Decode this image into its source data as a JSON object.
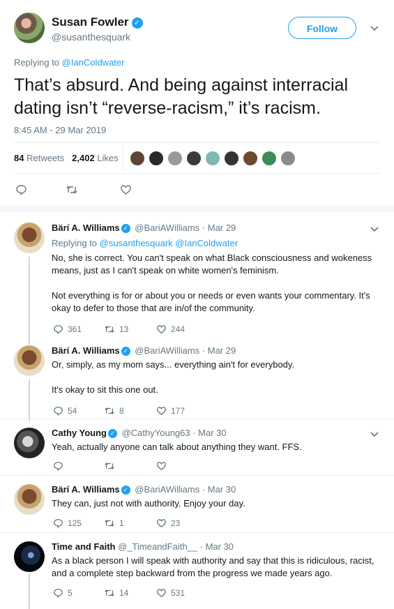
{
  "main_tweet": {
    "author_name": "Susan Fowler",
    "author_handle": "@susanthesquark",
    "follow_label": "Follow",
    "replying_prefix": "Replying to",
    "replying_to": "@IanColdwater",
    "text": "That’s absurd. And being against interracial dating isn’t “reverse-racism,” it’s racism.",
    "timestamp": "8:45 AM - 29 Mar 2019",
    "retweets_count": "84",
    "retweets_label": "Retweets",
    "likes_count": "2,402",
    "likes_label": "Likes"
  },
  "replies": [
    {
      "name": "Bärí A. Williams",
      "handle": "@BariAWilliams",
      "date": "· Mar 29",
      "replying_prefix": "Replying to",
      "replying_to": "@susanthesquark @IanColdwater",
      "text_1": "No, she is correct. You can't speak on what Black consciousness and wokeness means, just as I can't speak on white women's feminism.",
      "text_2": "Not everything is for or about you or needs or even wants your commentary. It's okay to defer to those that are in/of the community.",
      "replies": "361",
      "retweets": "13",
      "likes": "244"
    },
    {
      "name": "Bärí A. Williams",
      "handle": "@BariAWilliams",
      "date": "· Mar 29",
      "text_1": "Or, simply, as my mom says... everything ain't for everybody.",
      "text_2": "It's okay to sit this one out.",
      "replies": "54",
      "retweets": "8",
      "likes": "177"
    },
    {
      "name": "Cathy Young",
      "handle": "@CathyYoung63",
      "date": "· Mar 30",
      "text_1": "Yeah, actually anyone can talk about anything they want. FFS.",
      "replies": "",
      "retweets": "",
      "likes": ""
    },
    {
      "name": "Bärí A. Williams",
      "handle": "@BariAWilliams",
      "date": "· Mar 30",
      "text_1": "They can, just not with authority. Enjoy your day.",
      "replies": "125",
      "retweets": "1",
      "likes": "23"
    },
    {
      "name": "Time and Faith",
      "handle": "@_TimeandFaith__",
      "date": "· Mar 30",
      "text_1": "As a black person I will speak with authority and say that this is ridiculous, racist, and a complete step backward from the progress we made years ago.",
      "replies": "5",
      "retweets": "14",
      "likes": "531"
    }
  ],
  "colors": {
    "accent": "#1da1f2",
    "muted": "#657786",
    "divider": "#e6ecf0"
  }
}
